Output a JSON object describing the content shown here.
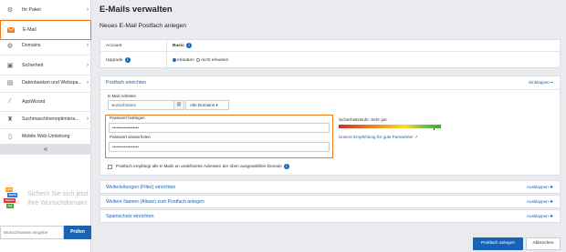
{
  "sidebar": {
    "items": [
      {
        "label": "Ihr Paket",
        "icon": "package-icon"
      },
      {
        "label": "E-Mail",
        "icon": "envelope-icon",
        "active": true
      },
      {
        "label": "Domains",
        "icon": "globe-icon"
      },
      {
        "label": "Sicherheit",
        "icon": "shield-icon"
      },
      {
        "label": "Datenbanken und Webspa...",
        "icon": "database-icon"
      },
      {
        "label": "AppWizard",
        "icon": "wand-icon"
      },
      {
        "label": "Suchmaschinenoptimiera...",
        "icon": "trophy-icon"
      },
      {
        "label": "Mobile Web-Umleitung",
        "icon": "mobile-icon"
      }
    ],
    "collapse_glyph": "«",
    "promo": {
      "badge_words": [
        "web",
        ".berlin",
        ".bayern",
        ".rep"
      ],
      "text": "Sichern Sie sich jetzt Ihre Wunschdomain!",
      "search_placeholder": "Wunschnamen eingebe",
      "search_button": "Prüfen"
    }
  },
  "main": {
    "title": "E-Mails verwalten",
    "subtitle": "Neues E-Mail Postfach anlegen",
    "info": {
      "account_label": "Account",
      "account_value": "Basic",
      "upgrade_label": "Upgrade",
      "allow_label": "erlauben",
      "deny_label": "nicht erlauben"
    },
    "mailbox": {
      "heading": "Postfach einrichten",
      "collapse_label": "Einklappen",
      "email_label": "E-Mail Adresse",
      "local_part": "wunschname",
      "at": "@",
      "domain_select": "Alle Domains",
      "password_label": "Passwort festlegen",
      "password_value": "••••••••••••••••••",
      "password_repeat_label": "Passwort wiederholen",
      "password_repeat_value": "••••••••••••••••••",
      "strength_label": "Sicherheitsstufe: Sehr gut",
      "strength_level": 0.93,
      "recommendation_link": "Unsere Empfehlung für gute Passwörter",
      "catchall_text": "Postfach empfängt alle E-Mails an undefinierte Adressen der oben ausgewählten Domain"
    },
    "accordions": [
      {
        "title": "Weiterleitungen (Filter) einrichten",
        "action": "Ausklappen"
      },
      {
        "title": "Weitere Namen (Aliase) zum Postfach anlegen",
        "action": "Ausklappen"
      },
      {
        "title": "Spamschutz einrichten",
        "action": "Ausklappen"
      }
    ],
    "actions": {
      "create": "Postfach anlegen",
      "cancel": "Abbrechen"
    }
  }
}
